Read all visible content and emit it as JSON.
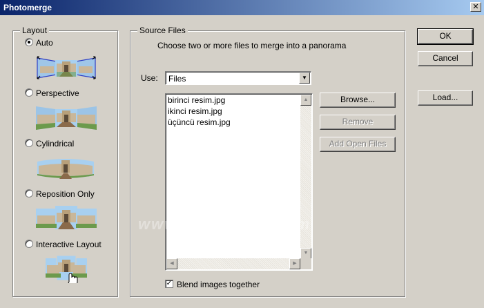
{
  "window": {
    "title": "Photomerge",
    "close_glyph": "✕"
  },
  "layout": {
    "legend": "Layout",
    "options": [
      {
        "label": "Auto",
        "selected": true,
        "thumb_icon": "auto-layout-preview"
      },
      {
        "label": "Perspective",
        "selected": false,
        "thumb_icon": "perspective-layout-preview"
      },
      {
        "label": "Cylindrical",
        "selected": false,
        "thumb_icon": "cylindrical-layout-preview"
      },
      {
        "label": "Reposition Only",
        "selected": false,
        "thumb_icon": "reposition-layout-preview"
      },
      {
        "label": "Interactive Layout",
        "selected": false,
        "thumb_icon": "interactive-layout-preview"
      }
    ]
  },
  "source": {
    "legend": "Source Files",
    "instruction": "Choose two or more files to merge into a panorama",
    "use_label": "Use:",
    "use_value": "Files",
    "files": [
      "birinci resim.jpg",
      "ikinci resim.jpg",
      "üçüncü resim.jpg"
    ],
    "browse": "Browse...",
    "remove": "Remove",
    "add_open": "Add Open Files",
    "blend_label": "Blend images together",
    "blend_checked": true
  },
  "buttons": {
    "ok": "OK",
    "cancel": "Cancel",
    "load": "Load..."
  },
  "watermark": "www.dijitalders.com",
  "colors": {
    "title_start": "#0a246a",
    "title_end": "#a6caf0",
    "face": "#d4d0c8",
    "selection_frame": "#3040c0"
  }
}
